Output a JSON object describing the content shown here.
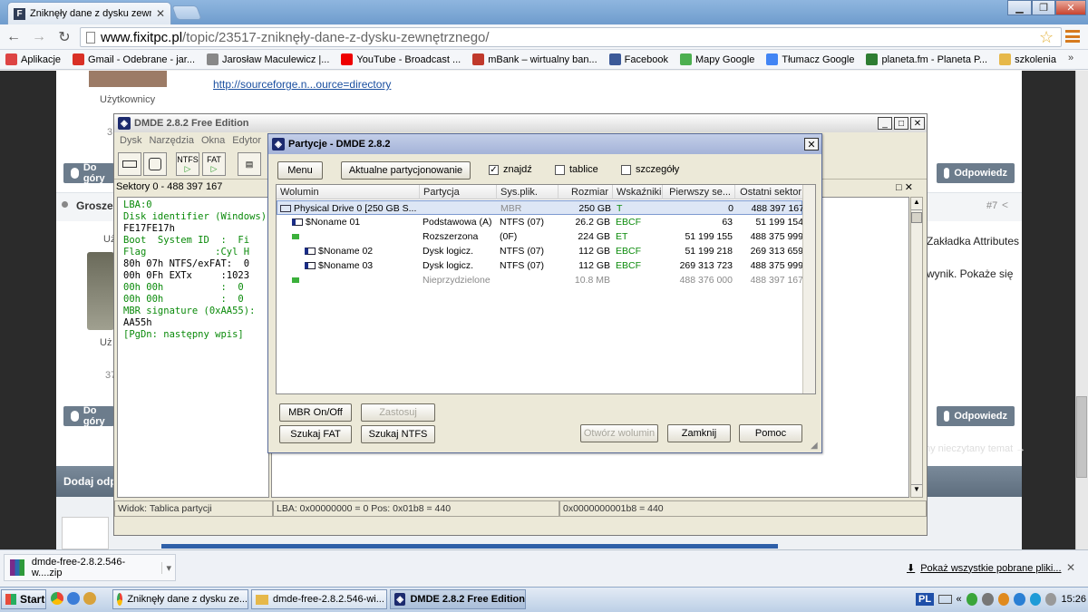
{
  "browser": {
    "tab_title": "Zniknęły dane z dysku zewnę",
    "url_host": "www.fixitpc.pl",
    "url_path": "/topic/23517-zniknęły-dane-z-dysku-zewnętrznego/",
    "bookmarks": [
      {
        "label": "Aplikacje",
        "icon": "apps-grid-icon",
        "color": "#d44"
      },
      {
        "label": "Gmail - Odebrane - jar...",
        "icon": "gmail-icon",
        "color": "#d93025"
      },
      {
        "label": "Jarosław Maculewicz |...",
        "icon": "page-icon",
        "color": "#888"
      },
      {
        "label": "YouTube - Broadcast ...",
        "icon": "youtube-icon",
        "color": "#e00"
      },
      {
        "label": "mBank – wirtualny ban...",
        "icon": "mbank-icon",
        "color": "#c0392b"
      },
      {
        "label": "Facebook",
        "icon": "facebook-icon",
        "color": "#3b5998"
      },
      {
        "label": "Mapy Google",
        "icon": "maps-icon",
        "color": "#4caf50"
      },
      {
        "label": "Tłumacz Google",
        "icon": "translate-icon",
        "color": "#4285f4"
      },
      {
        "label": "planeta.fm - Planeta P...",
        "icon": "planeta-icon",
        "color": "#2e7d32"
      },
      {
        "label": "szkolenia",
        "icon": "folder-icon",
        "color": "#e6b84a"
      }
    ]
  },
  "forum": {
    "user_label": "Użytkownicy",
    "link": "http://sourceforge.n...ource=directory",
    "post_author": "Groszek",
    "post_num": "#7",
    "text1": "Zakładka Attributes",
    "text2": "wynik. Pokaże się",
    "reply_label": "Odpowiedz",
    "top_label": "Do góry",
    "unread": "ny nieczytany temat →",
    "add_reply": "Dodaj odpowiedź",
    "user_short": "Uż",
    "num37": "37",
    "num3": "3"
  },
  "dmde": {
    "title": "DMDE 2.8.2 Free Edition",
    "menu": [
      "Dysk",
      "Narzędzia",
      "Okna",
      "Edytor"
    ],
    "tool_ntfs": "NTFS",
    "tool_fat": "FAT",
    "sectors": "Sektory 0 - 488 397 167",
    "hex_lines": [
      {
        "t": "LBA:0",
        "c": "g"
      },
      {
        "t": "Disk identifier (Windows)",
        "c": "g"
      },
      {
        "t": "FE17FE17h",
        "c": "k"
      },
      {
        "t": "Boot  System ID  :  Fi",
        "c": "g"
      },
      {
        "t": "Flag            :Cyl H",
        "c": "g"
      },
      {
        "t": "80h 07h NTFS/exFAT:  0",
        "c": "k"
      },
      {
        "t": "00h 0Fh EXTx     :1023",
        "c": "k"
      },
      {
        "t": "00h 00h          :  0",
        "c": "g"
      },
      {
        "t": "00h 00h          :  0",
        "c": "g"
      },
      {
        "t": "MBR signature (0xAA55):",
        "c": "g"
      },
      {
        "t": "AA55h",
        "c": "k"
      },
      {
        "t": "[PgDn: następny wpis]",
        "c": "g"
      }
    ],
    "status": [
      "Widok: Tablica partycji",
      "LBA: 0x00000000 = 0  Pos: 0x01b8 = 440",
      "0x0000000001b8 = 440"
    ]
  },
  "dialog": {
    "title": "Partycje - DMDE 2.8.2",
    "menu_btn": "Menu",
    "actual_btn": "Aktualne partycjonowanie",
    "checks": [
      {
        "label": "znajdź",
        "checked": true
      },
      {
        "label": "tablice",
        "checked": false
      },
      {
        "label": "szczegóły",
        "checked": false
      }
    ],
    "columns": [
      "Wolumin",
      "Partycja",
      "Sys.plik.",
      "Rozmiar",
      "Wskaźniki",
      "Pierwszy se...",
      "Ostatni sektor"
    ],
    "rows": [
      {
        "vol": "Physical Drive 0 [250 GB S...",
        "part": "",
        "fs": "MBR",
        "size": "250 GB",
        "flags": "T",
        "first": "0",
        "last": "488 397 167",
        "kind": "disk"
      },
      {
        "vol": "$Noname 01",
        "part": "Podstawowa (A)",
        "fs": "NTFS (07)",
        "size": "26.2 GB",
        "flags": "EBCF",
        "first": "63",
        "last": "51 199 154",
        "kind": "part"
      },
      {
        "vol": "",
        "part": "Rozszerzona",
        "fs": "(0F)",
        "size": "224 GB",
        "flags": "ET",
        "first": "51 199 155",
        "last": "488 375 999",
        "kind": "ext"
      },
      {
        "vol": "$Noname 02",
        "part": "Dysk logicz.",
        "fs": "NTFS (07)",
        "size": "112 GB",
        "flags": "EBCF",
        "first": "51 199 218",
        "last": "269 313 659",
        "kind": "logical"
      },
      {
        "vol": "$Noname 03",
        "part": "Dysk logicz.",
        "fs": "NTFS (07)",
        "size": "112 GB",
        "flags": "EBCF",
        "first": "269 313 723",
        "last": "488 375 999",
        "kind": "logical"
      },
      {
        "vol": "",
        "part": "Nieprzydzielone",
        "fs": "",
        "size": "10.8 MB",
        "flags": "",
        "first": "488 376 000",
        "last": "488 397 167",
        "kind": "free"
      }
    ],
    "buttons": {
      "mbr": "MBR On/Off",
      "apply": "Zastosuj",
      "fat": "Szukaj FAT",
      "ntfs": "Szukaj NTFS",
      "open": "Otwórz wolumin",
      "close": "Zamknij",
      "help": "Pomoc"
    }
  },
  "shelf": {
    "file": "dmde-free-2.8.2.546-w....zip",
    "show_all": "Pokaż wszystkie pobrane pliki..."
  },
  "taskbar": {
    "start": "Start",
    "items": [
      "Zniknęły dane z dysku ze...",
      "dmde-free-2.8.2.546-wi...",
      "DMDE 2.8.2 Free Edition"
    ],
    "lang": "PL",
    "time": "15:26"
  }
}
